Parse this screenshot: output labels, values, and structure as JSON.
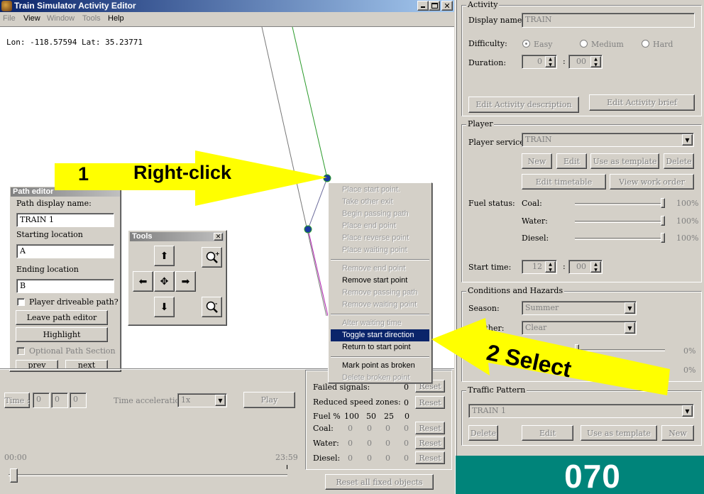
{
  "window": {
    "title": "Train Simulator Activity Editor",
    "menu": [
      "File",
      "View",
      "Window",
      "Tools",
      "Help"
    ]
  },
  "map": {
    "coords": "Lon: -118.57594 Lat: 35.23771"
  },
  "callouts": {
    "step1_num": "1",
    "step1_text": "Right-click",
    "step2_text": "2 Select"
  },
  "path_editor": {
    "title": "Path editor",
    "display_name_label": "Path display name:",
    "display_name": "TRAIN 1",
    "start_label": "Starting location",
    "start_value": "A",
    "end_label": "Ending location",
    "end_value": "B",
    "driveable_label": "Player driveable path?",
    "leave_button": "Leave path editor",
    "highlight_button": "Highlight",
    "optional_label": "Optional Path Section",
    "prev_button": "prev",
    "next_button": "next"
  },
  "tools": {
    "title": "Tools"
  },
  "context_menu": {
    "items": [
      "Place start point.",
      "Take other exit",
      "Begin passing path",
      "Place end point",
      "Place reverse point",
      "Place waiting point",
      "Remove end point",
      "Remove start point",
      "Remove passing path",
      "Remove waiting point",
      "Alter waiting time",
      "Toggle start direction",
      "Return to start point",
      "Mark point as broken",
      "Delete broken point"
    ]
  },
  "playback": {
    "time_label": "Time :",
    "time_values": [
      "0",
      "0",
      "0"
    ],
    "accel_label": "Time acceleration",
    "accel_value": "1x",
    "play_button": "Play",
    "time_start": "00:00",
    "time_end": "23:59"
  },
  "hazards": {
    "failed_signals": "Failed signals:",
    "failed_value": "0",
    "reduced_speed": "Reduced speed zones:",
    "reduced_value": "0",
    "reset": "Reset",
    "fuel_label": "Fuel %",
    "fuel_columns": [
      "100",
      "50",
      "25",
      "0"
    ],
    "rows": [
      {
        "label": "Coal:",
        "values": [
          "0",
          "0",
          "0",
          "0"
        ]
      },
      {
        "label": "Water:",
        "values": [
          "0",
          "0",
          "0",
          "0"
        ]
      },
      {
        "label": "Diesel:",
        "values": [
          "0",
          "0",
          "0",
          "0"
        ]
      }
    ],
    "reset_all": "Reset all fixed objects"
  },
  "activity": {
    "group": "Activity",
    "display_name_label": "Display name:",
    "display_name": "TRAIN",
    "difficulty_label": "Difficulty:",
    "difficulty": [
      "Easy",
      "Medium",
      "Hard"
    ],
    "duration_label": "Duration:",
    "duration_h": "0",
    "duration_m": "00",
    "edit_description": "Edit Activity description",
    "edit_brief": "Edit Activity brief"
  },
  "player": {
    "group": "Player",
    "service_label": "Player service:",
    "service": "TRAIN",
    "new": "New",
    "edit": "Edit",
    "use_template": "Use as template",
    "delete": "Delete",
    "edit_timetable": "Edit timetable",
    "view_work_order": "View work order",
    "fuel_label": "Fuel status:",
    "coal": "Coal:",
    "water": "Water:",
    "diesel": "Diesel:",
    "pct": "100%",
    "start_time_label": "Start time:",
    "start_h": "12",
    "start_m": "00"
  },
  "conditions": {
    "group": "Conditions and Hazards",
    "season_label": "Season:",
    "season": "Summer",
    "weather_label": "Weather:",
    "weather": "Clear",
    "pct_a": "0%",
    "pct_b": "0%"
  },
  "traffic": {
    "group": "Traffic Pattern",
    "pattern": "TRAIN 1",
    "delete": "Delete",
    "edit": "Edit",
    "use_template": "Use as template",
    "new": "New"
  },
  "page_number": "070",
  "colors": {
    "title_bar": "#0a246a",
    "teal_footer": "#00847a",
    "callout": "#ffff00",
    "menu_highlight": "#0a246a"
  }
}
